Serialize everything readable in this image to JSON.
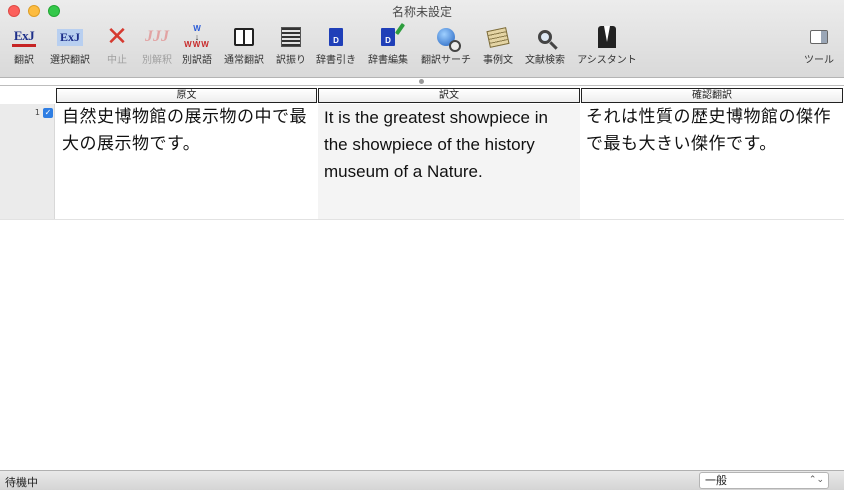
{
  "window": {
    "title": "名称未設定"
  },
  "toolbar": {
    "items": [
      {
        "label": "翻訳",
        "icon": "translate-ej-icon"
      },
      {
        "label": "選択翻訳",
        "icon": "selection-translate-icon"
      },
      {
        "label": "中止",
        "icon": "stop-icon",
        "disabled": true
      },
      {
        "label": "別解釈",
        "icon": "alternate-interpretation-icon",
        "disabled": true
      },
      {
        "label": "別訳語",
        "icon": "alternate-word-icon"
      },
      {
        "label": "通常翻訳",
        "icon": "normal-translate-icon"
      },
      {
        "label": "訳振り",
        "icon": "interlinear-icon"
      },
      {
        "label": "辞書引き",
        "icon": "dictionary-lookup-icon"
      },
      {
        "label": "辞書編集",
        "icon": "dictionary-edit-icon"
      },
      {
        "label": "翻訳サーチ",
        "icon": "translation-search-icon"
      },
      {
        "label": "事例文",
        "icon": "example-sentence-icon"
      },
      {
        "label": "文献検索",
        "icon": "literature-search-icon"
      },
      {
        "label": "アシスタント",
        "icon": "assistant-icon"
      }
    ],
    "tools_label": "ツール",
    "icon_text": {
      "exj": "ExJ",
      "jjj": "JJJ",
      "w_top": "W",
      "arrow": "↓",
      "w_bottom": "WWW",
      "dict_letter": "D"
    }
  },
  "table": {
    "headers": [
      "原文",
      "訳文",
      "確認翻訳"
    ],
    "rows": [
      {
        "number": "1",
        "checked": true,
        "source": "自然史博物館の展示物の中で最大の展示物です。",
        "translation": "It is the greatest showpiece in the showpiece of the history museum of a Nature.",
        "confirmation": "それは性質の歴史博物館の傑作で最も大きい傑作です。"
      }
    ]
  },
  "status": {
    "text": "待機中",
    "mode": "一般"
  },
  "colors": {
    "check_blue": "#2f7ee3",
    "close_red": "#fc605c",
    "minimize_yellow": "#fdbc40",
    "maximize_green": "#34c84a"
  }
}
